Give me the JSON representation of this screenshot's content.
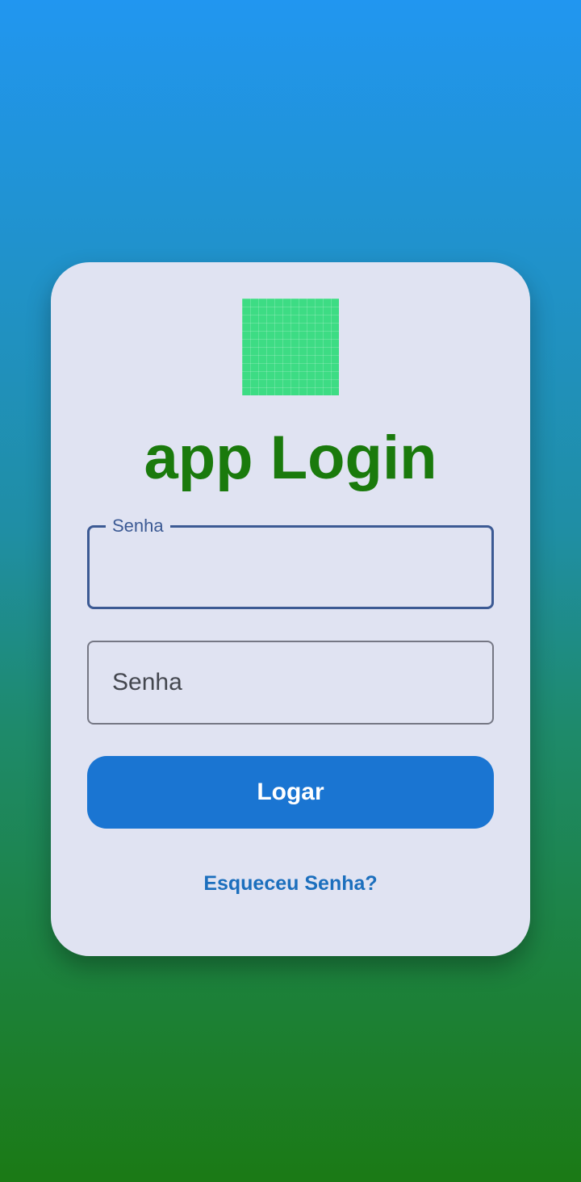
{
  "app": {
    "title": "app Login",
    "logo_icon": "android-grid-icon",
    "logo_color": "#3ddc84"
  },
  "form": {
    "user_field_label": "Senha",
    "user_field_value": "",
    "password_placeholder": "Senha",
    "login_button_label": "Logar",
    "forgot_link": "Esqueceu Senha?"
  },
  "colors": {
    "title": "#1a7a0c",
    "button": "#1a75d2",
    "link": "#1c6fbd",
    "focused_border": "#3c5a94",
    "card_bg": "#e0e3f2"
  }
}
